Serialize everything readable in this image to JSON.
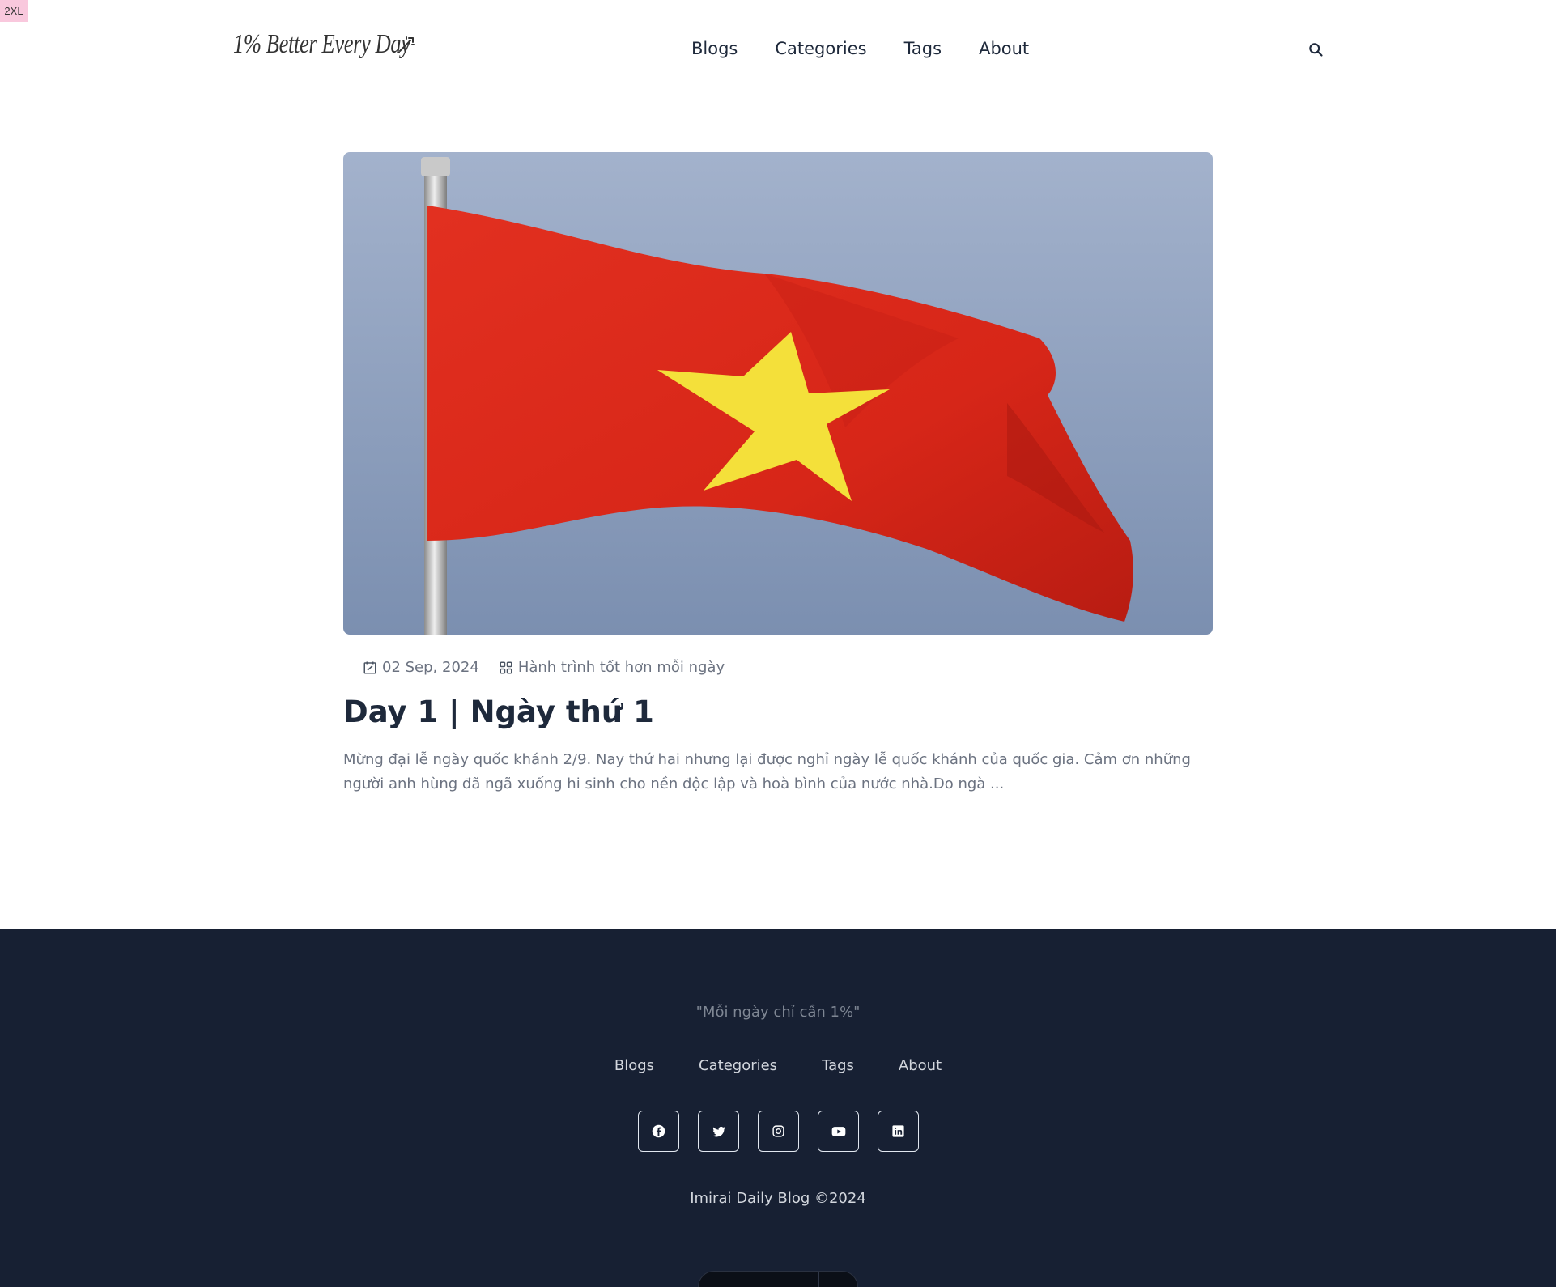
{
  "breakpoint_badge": "2XL",
  "header": {
    "logo_text": "1% Better Every Day",
    "logo_icon": "magic-wand-icon",
    "nav": [
      "Blogs",
      "Categories",
      "Tags",
      "About"
    ],
    "search_icon": "search-icon"
  },
  "post": {
    "image_alt": "Vietnam flag",
    "date": "02 Sep, 2024",
    "category": "Hành trình tốt hơn mỗi ngày",
    "title": "Day 1 | Ngày thứ 1",
    "excerpt": "Mừng đại lễ ngày quốc khánh 2/9. Nay thứ hai nhưng lại được nghỉ ngày lễ quốc khánh của quốc gia. Cảm ơn những người anh hùng đã ngã xuống hi sinh cho nền độc lập và hoà bình của nước nhà.Do ngà ..."
  },
  "footer": {
    "quote": "\"Mỗi ngày chỉ cần 1%\"",
    "nav": [
      "Blogs",
      "Categories",
      "Tags",
      "About"
    ],
    "socials": [
      "facebook-icon",
      "twitter-icon",
      "instagram-icon",
      "youtube-icon",
      "linkedin-icon"
    ],
    "copyright": "Imirai Daily Blog ©2024"
  },
  "colors": {
    "footer_bg": "#172033",
    "text_dark": "#1e293b",
    "text_muted": "#6b7280",
    "flag_red": "#d8281c",
    "flag_star": "#f4e03a",
    "sky": "#8fa3c0"
  }
}
